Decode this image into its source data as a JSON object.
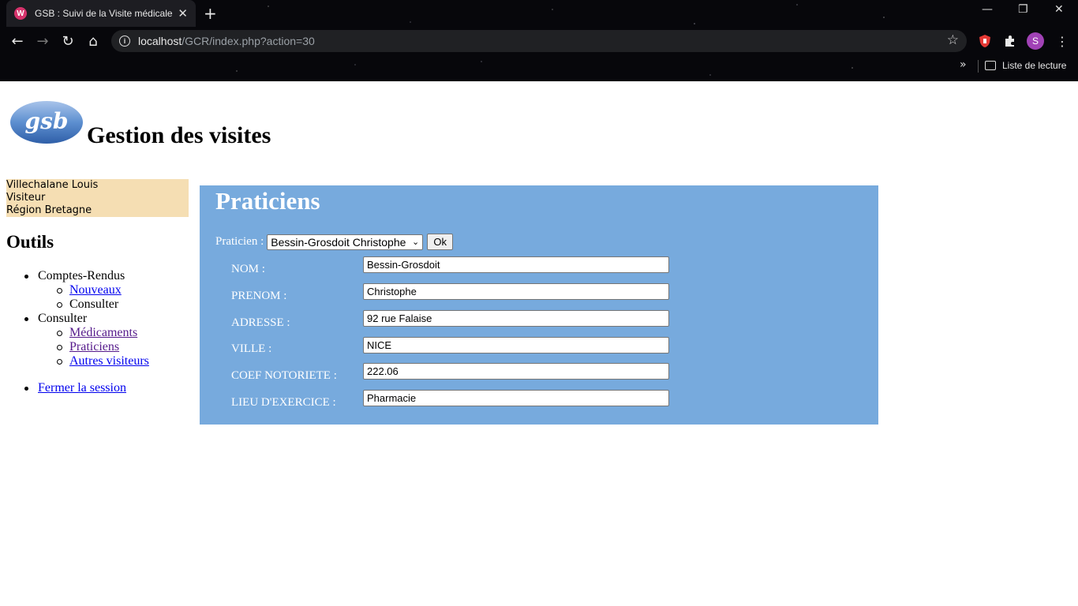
{
  "browser": {
    "tab_title": "GSB : Suivi de la Visite médicale",
    "url_host": "localhost",
    "url_path": "/GCR/index.php?action=30",
    "avatar_letter": "S",
    "reading_list_label": "Liste de lecture"
  },
  "header": {
    "logo_text": "gsb",
    "title": "Gestion des visites"
  },
  "user": {
    "name": "Villechalane Louis",
    "role": "Visiteur",
    "region": "Région Bretagne"
  },
  "sidebar": {
    "heading": "Outils",
    "groups": [
      {
        "label": "Comptes-Rendus",
        "items": [
          "Nouveaux",
          "Consulter"
        ]
      },
      {
        "label": "Consulter",
        "items": [
          "Médicaments",
          "Praticiens",
          "Autres visiteurs"
        ]
      }
    ],
    "logout": "Fermer la session"
  },
  "main": {
    "title": "Praticiens",
    "select_label": "Praticien :",
    "selected_praticien": "Bessin-Grosdoit Christophe",
    "ok_label": "Ok",
    "fields": [
      {
        "label": "NOM :",
        "value": "Bessin-Grosdoit"
      },
      {
        "label": "PRENOM :",
        "value": "Christophe"
      },
      {
        "label": "ADRESSE :",
        "value": "92 rue Falaise"
      },
      {
        "label": "VILLE :",
        "value": "NICE"
      },
      {
        "label": "COEF NOTORIETE :",
        "value": "222.06"
      },
      {
        "label": "LIEU D'EXERCICE :",
        "value": "Pharmacie"
      }
    ]
  }
}
